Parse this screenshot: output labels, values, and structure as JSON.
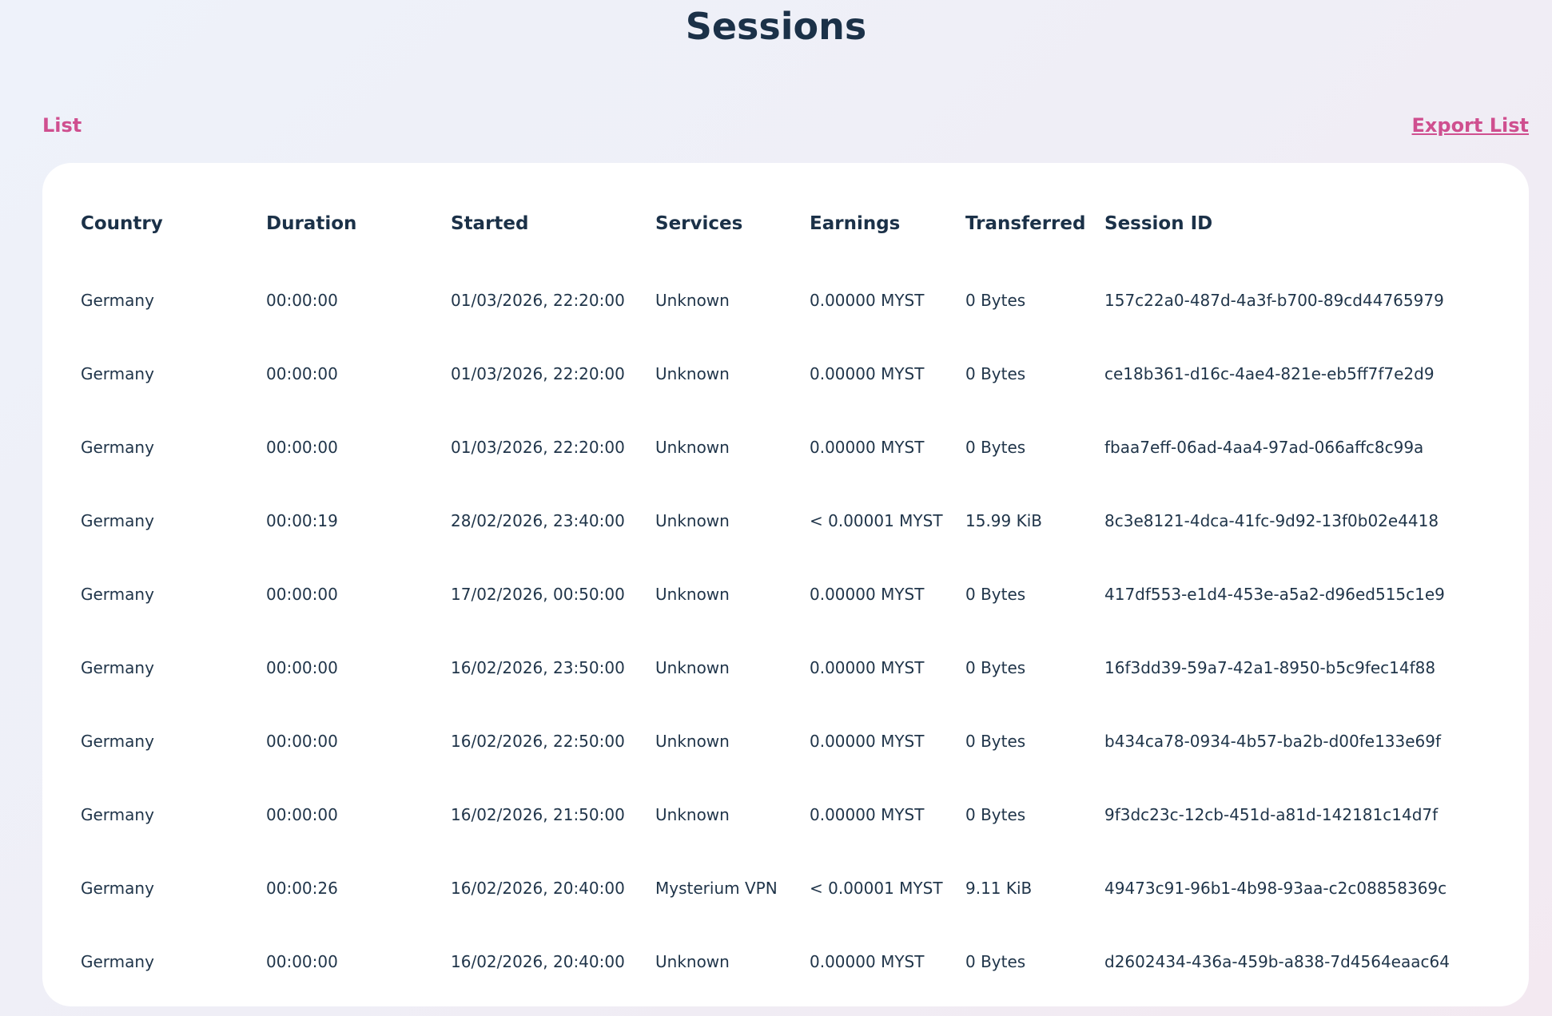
{
  "page": {
    "title": "Sessions",
    "list_tab": "List",
    "export_link": "Export List"
  },
  "table": {
    "columns": [
      "Country",
      "Duration",
      "Started",
      "Services",
      "Earnings",
      "Transferred",
      "Session ID"
    ],
    "rows": [
      [
        "Germany",
        "00:00:00",
        "01/03/2026, 22:20:00",
        "Unknown",
        "0.00000 MYST",
        "0 Bytes",
        "157c22a0-487d-4a3f-b700-89cd44765979"
      ],
      [
        "Germany",
        "00:00:00",
        "01/03/2026, 22:20:00",
        "Unknown",
        "0.00000 MYST",
        "0 Bytes",
        "ce18b361-d16c-4ae4-821e-eb5ff7f7e2d9"
      ],
      [
        "Germany",
        "00:00:00",
        "01/03/2026, 22:20:00",
        "Unknown",
        "0.00000 MYST",
        "0 Bytes",
        "fbaa7eff-06ad-4aa4-97ad-066affc8c99a"
      ],
      [
        "Germany",
        "00:00:19",
        "28/02/2026, 23:40:00",
        "Unknown",
        "< 0.00001 MYST",
        "15.99 KiB",
        "8c3e8121-4dca-41fc-9d92-13f0b02e4418"
      ],
      [
        "Germany",
        "00:00:00",
        "17/02/2026, 00:50:00",
        "Unknown",
        "0.00000 MYST",
        "0 Bytes",
        "417df553-e1d4-453e-a5a2-d96ed515c1e9"
      ],
      [
        "Germany",
        "00:00:00",
        "16/02/2026, 23:50:00",
        "Unknown",
        "0.00000 MYST",
        "0 Bytes",
        "16f3dd39-59a7-42a1-8950-b5c9fec14f88"
      ],
      [
        "Germany",
        "00:00:00",
        "16/02/2026, 22:50:00",
        "Unknown",
        "0.00000 MYST",
        "0 Bytes",
        "b434ca78-0934-4b57-ba2b-d00fe133e69f"
      ],
      [
        "Germany",
        "00:00:00",
        "16/02/2026, 21:50:00",
        "Unknown",
        "0.00000 MYST",
        "0 Bytes",
        "9f3dc23c-12cb-451d-a81d-142181c14d7f"
      ],
      [
        "Germany",
        "00:00:26",
        "16/02/2026, 20:40:00",
        "Mysterium VPN",
        "< 0.00001 MYST",
        "9.11 KiB",
        "49473c91-96b1-4b98-93aa-c2c08858369c"
      ],
      [
        "Germany",
        "00:00:00",
        "16/02/2026, 20:40:00",
        "Unknown",
        "0.00000 MYST",
        "0 Bytes",
        "d2602434-436a-459b-a838-7d4564eaac64"
      ]
    ]
  },
  "colors": {
    "title": "#1b3148",
    "accent": "#cf4f8f",
    "card_background": "#ffffff"
  }
}
